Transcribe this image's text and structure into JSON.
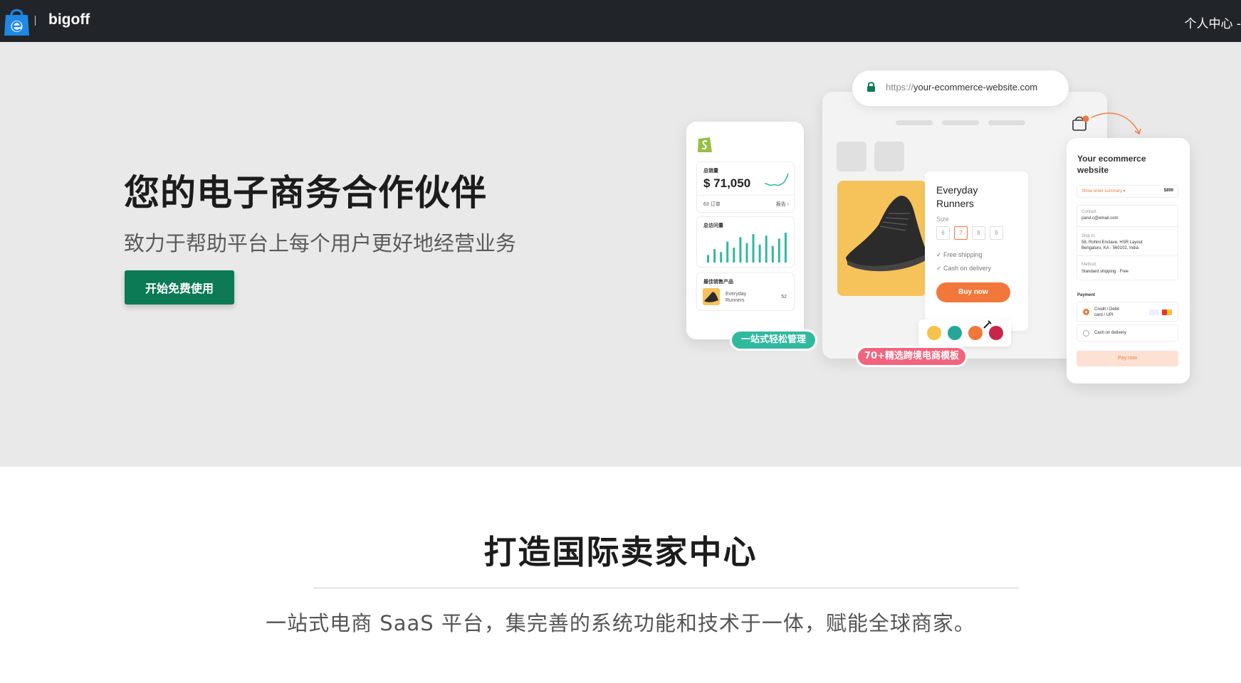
{
  "nav": {
    "brand": "bigoff",
    "user_menu": "个人中心 -"
  },
  "hero": {
    "title": "您的电子商务合作伙伴",
    "subtitle": "致力于帮助平台上每个用户更好地经营业务",
    "cta_label": "开始免费使用"
  },
  "illustration": {
    "url_protocol": "https://",
    "url_domain": "your-ecommerce-website.com",
    "phone": {
      "sales_label": "总销量",
      "sales_value": "$ 71,050",
      "orders": "63 订单",
      "report": "报告 ›",
      "visits_label": "总访问量",
      "best_label": "最佳销售产品",
      "best_product": "Everyday Runners",
      "best_count": "52",
      "bars": [
        0.25,
        0.45,
        0.35,
        0.7,
        0.5,
        0.85,
        0.65,
        0.95,
        0.6,
        0.9,
        0.55,
        0.8,
        1.0
      ]
    },
    "product": {
      "name_line1": "Everyday",
      "name_line2": "Runners",
      "size_label": "Size",
      "sizes": [
        "6",
        "7",
        "8",
        "9"
      ],
      "selected_size": "7",
      "feature1": "Free shipping",
      "feature2": "Cash on delivery",
      "buy_label": "Buy now",
      "swatches": [
        "#f7c24a",
        "#26a69a",
        "#f2773a",
        "#c8254a"
      ]
    },
    "checkout": {
      "title_line1": "Your ecommerce",
      "title_line2": "website",
      "summary": "Show order summary ▾",
      "price": "$899",
      "contact_label": "Contact",
      "contact_value": "parul.c@email.com",
      "ship_label": "Ship to",
      "ship_value1": "58, Rohini Enclave, HSR Layout",
      "ship_value2": "Bengaluru, KA - 560102, India",
      "method_label": "Method",
      "method_value": "Standard shipping · Free",
      "payment_label": "Payment",
      "pay_option1_line1": "Credit / Debit",
      "pay_option1_line2": "card / UPI",
      "pay_option2": "Cash on delivery",
      "pay_button": "Pay now"
    },
    "badge_green": "一站式轻松管理",
    "badge_pink": "70+精选跨境电商模板"
  },
  "section": {
    "title": "打造国际卖家中心",
    "description": "一站式电商 SaaS 平台，集完善的系统功能和技术于一体，赋能全球商家。"
  },
  "colors": {
    "nav_bg": "#212529",
    "hero_bg": "#e9e9e9",
    "cta_bg": "#0b7a55",
    "accent_orange": "#f2773a",
    "accent_teal": "#2fb9a0",
    "accent_pink": "#f2647e"
  }
}
